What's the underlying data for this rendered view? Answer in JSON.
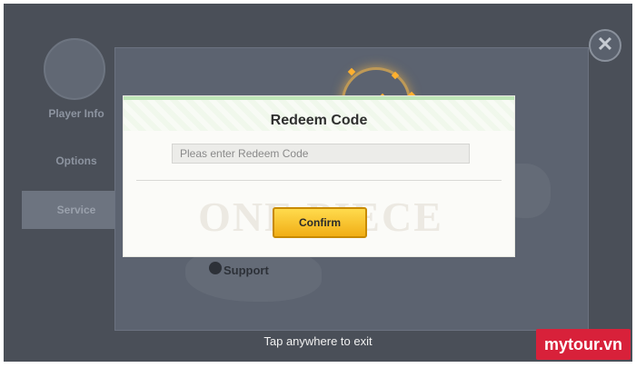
{
  "background": {
    "menu": [
      {
        "label": "Player Info"
      },
      {
        "label": "Options"
      },
      {
        "label": "Service"
      }
    ],
    "support_label": "Support"
  },
  "dialog": {
    "title": "Redeem Code",
    "input_placeholder": "Pleas enter Redeem Code",
    "input_value": "",
    "watermark": "ONE PIECE",
    "confirm_label": "Confirm"
  },
  "exit_hint": "Tap anywhere to exit",
  "brand": "mytour.vn",
  "colors": {
    "accent_button": "#f7c52b",
    "brand_red": "#d8213a",
    "overlay": "#4a4f58"
  }
}
